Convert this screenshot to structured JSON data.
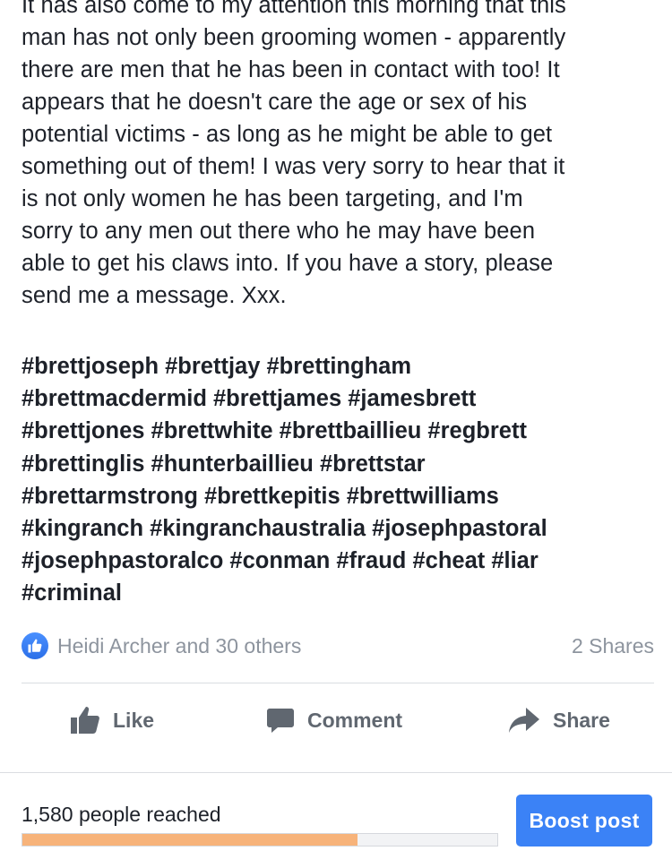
{
  "post": {
    "lines": [
      "It has also come to my attention this morning that this",
      "man has not only been grooming women - apparently",
      "there are men that he has been in contact with too! It",
      "appears that he doesn't care the age or sex of his",
      "potential victims - as long as he might be able to get",
      "something out of them! I was very sorry to hear that it",
      "is not only women he has been targeting, and I'm",
      "sorry to any men out there who he may have been",
      "able to get his claws into. If you have a story, please",
      "send me a message. Xxx."
    ],
    "hashtag_lines": [
      "#brettjoseph #brettjay #brettingham",
      "#brettmacdermid #brettjames #jamesbrett",
      "#brettjones #brettwhite #brettbaillieu #regbrett",
      "#brettinglis #hunterbaillieu #brettstar",
      "#brettarmstrong #brettkepitis #brettwilliams",
      "#kingranch #kingranchaustralia #josephpastoral",
      "#josephpastoralco #conman #fraud #cheat #liar",
      "#criminal"
    ]
  },
  "reactions": {
    "icon": "thumbs-up-icon",
    "reactors_text": "Heidi Archer and 30 others",
    "shares_text": "2 Shares"
  },
  "actions": {
    "like_label": "Like",
    "comment_label": "Comment",
    "share_label": "Share"
  },
  "insights": {
    "reach_text": "1,580 people reached",
    "reach_progress_fraction": 0.705,
    "boost_label": "Boost post"
  },
  "colors": {
    "accent": "#3b82f6",
    "progress": "#f7b37a",
    "muted_text": "#8d949e",
    "action_text": "#606770"
  }
}
